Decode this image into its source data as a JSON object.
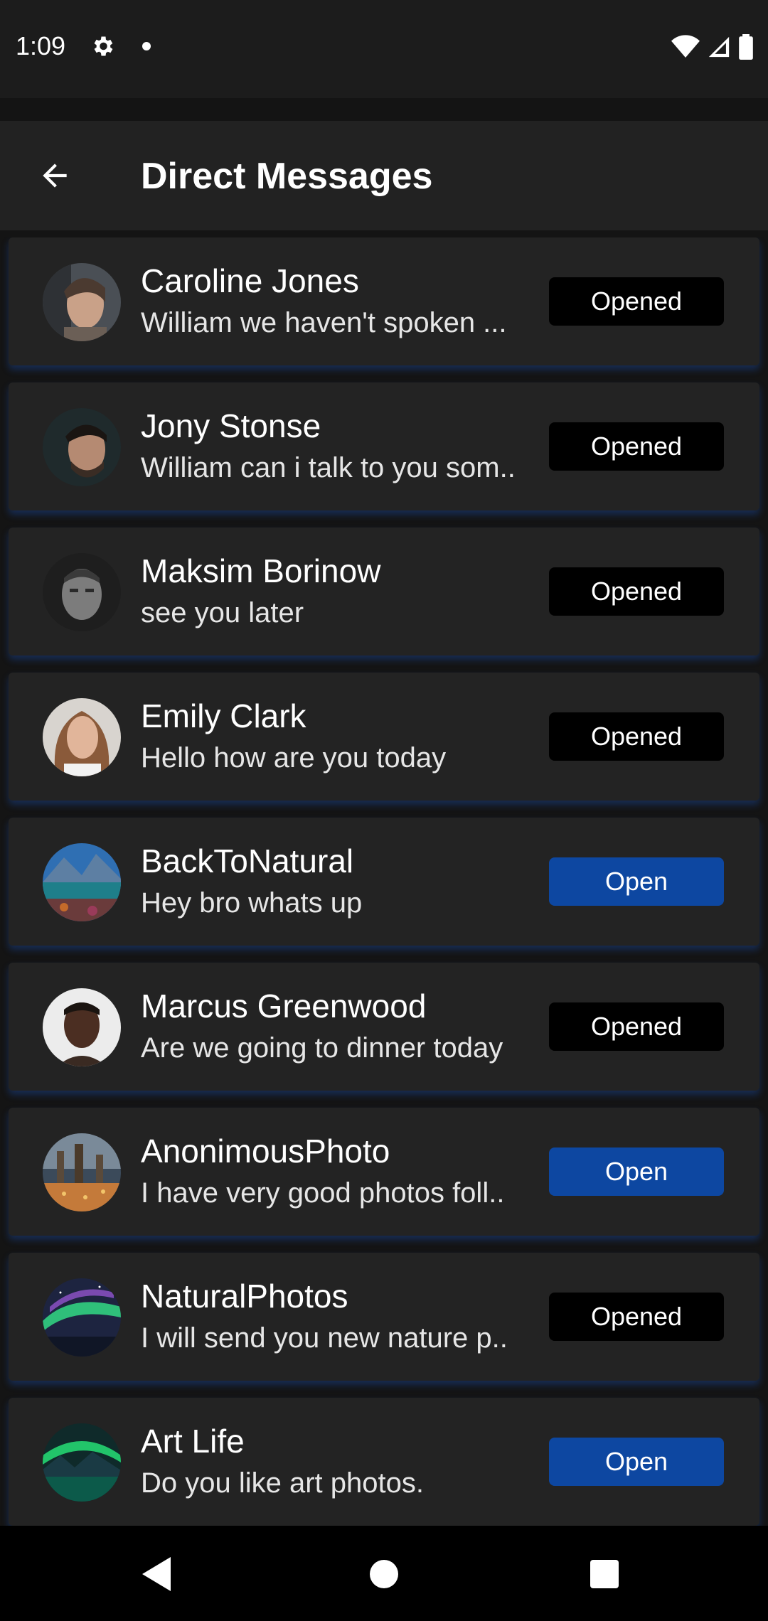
{
  "status_bar": {
    "time": "1:09"
  },
  "app_bar": {
    "title": "Direct Messages"
  },
  "conversations": [
    {
      "name": "Caroline Jones",
      "preview": "William we haven't spoken ...",
      "status": "Opened"
    },
    {
      "name": "Jony Stonse",
      "preview": "William can i talk to you som..",
      "status": "Opened"
    },
    {
      "name": "Maksim Borinow",
      "preview": "see you later",
      "status": "Opened"
    },
    {
      "name": "Emily Clark",
      "preview": "Hello how are you today",
      "status": "Opened"
    },
    {
      "name": "BackToNatural",
      "preview": "Hey bro whats up",
      "status": "Open"
    },
    {
      "name": "Marcus Greenwood",
      "preview": "Are we going to dinner today",
      "status": "Opened"
    },
    {
      "name": "AnonimousPhoto",
      "preview": "I have very good photos foll..",
      "status": "Open"
    },
    {
      "name": "NaturalPhotos",
      "preview": "I will send you new nature p..",
      "status": "Opened"
    },
    {
      "name": "Art Life",
      "preview": "Do you like art photos.",
      "status": "Open"
    }
  ],
  "colors": {
    "open_button": "#0d47a1",
    "opened_button": "#000000",
    "card": "#232323",
    "app_bar": "#222222"
  }
}
